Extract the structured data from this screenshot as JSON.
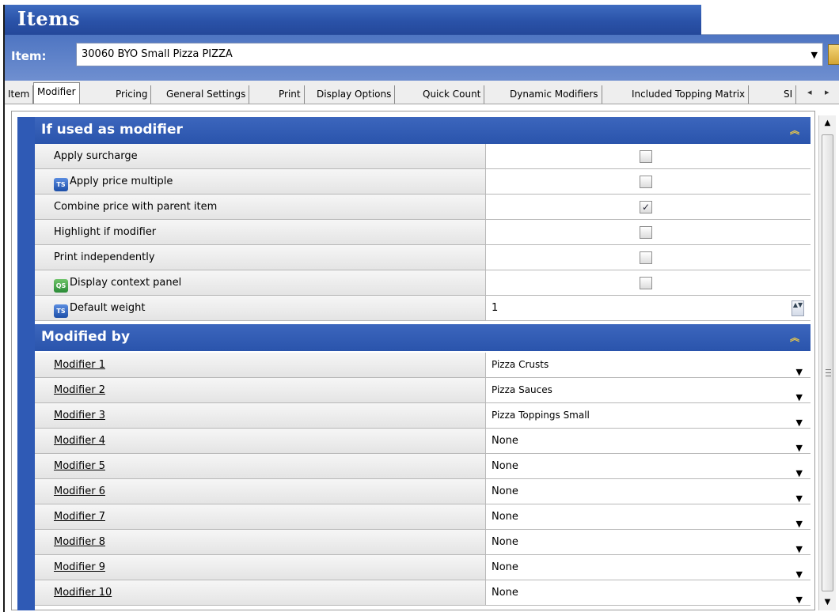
{
  "window": {
    "title": "Items"
  },
  "item": {
    "label": "Item:",
    "value": "30060 BYO Small Pizza PIZZA"
  },
  "tabs": [
    "Item",
    "Modifier",
    "Pricing",
    "General Settings",
    "Print",
    "Display Options",
    "Quick Count",
    "Dynamic Modifiers",
    "Included Topping Matrix",
    "SI"
  ],
  "active_tab": "Modifier",
  "groups": {
    "used_as_modifier": {
      "title": "If used as modifier",
      "rows": [
        {
          "label": "Apply surcharge",
          "checked": false
        },
        {
          "label": "Apply price multiple",
          "icon": "ts-icon",
          "checked": false
        },
        {
          "label": "Combine price with parent item",
          "checked": true
        },
        {
          "label": "Highlight if modifier",
          "checked": false
        },
        {
          "label": "Print independently",
          "checked": false
        },
        {
          "label": "Display context panel",
          "icon": "qs-icon",
          "checked": false
        }
      ],
      "default_weight": {
        "label": "Default weight",
        "icon": "ts-icon",
        "value": "1"
      }
    },
    "modified_by": {
      "title": "Modified by",
      "rows": [
        {
          "label": "Modifier 1",
          "value": "Pizza Crusts"
        },
        {
          "label": "Modifier 2",
          "value": "Pizza Sauces"
        },
        {
          "label": "Modifier 3",
          "value": "Pizza Toppings Small"
        },
        {
          "label": "Modifier 4",
          "value": "None"
        },
        {
          "label": "Modifier 5",
          "value": "None"
        },
        {
          "label": "Modifier 6",
          "value": "None"
        },
        {
          "label": "Modifier 7",
          "value": "None"
        },
        {
          "label": "Modifier 8",
          "value": "None"
        },
        {
          "label": "Modifier 9",
          "value": "None"
        },
        {
          "label": "Modifier 10",
          "value": "None"
        }
      ]
    }
  },
  "glyphs": {
    "checkmark": "✓",
    "dropdown": "▼",
    "collapse": "︽",
    "spin": "▲▼",
    "tab_left": "◂",
    "tab_right": "▸",
    "scroll_up": "▲",
    "scroll_down": "▼"
  },
  "colors": {
    "header_blue": "#2a54ac",
    "accent_blue": "#2f5ab5"
  }
}
